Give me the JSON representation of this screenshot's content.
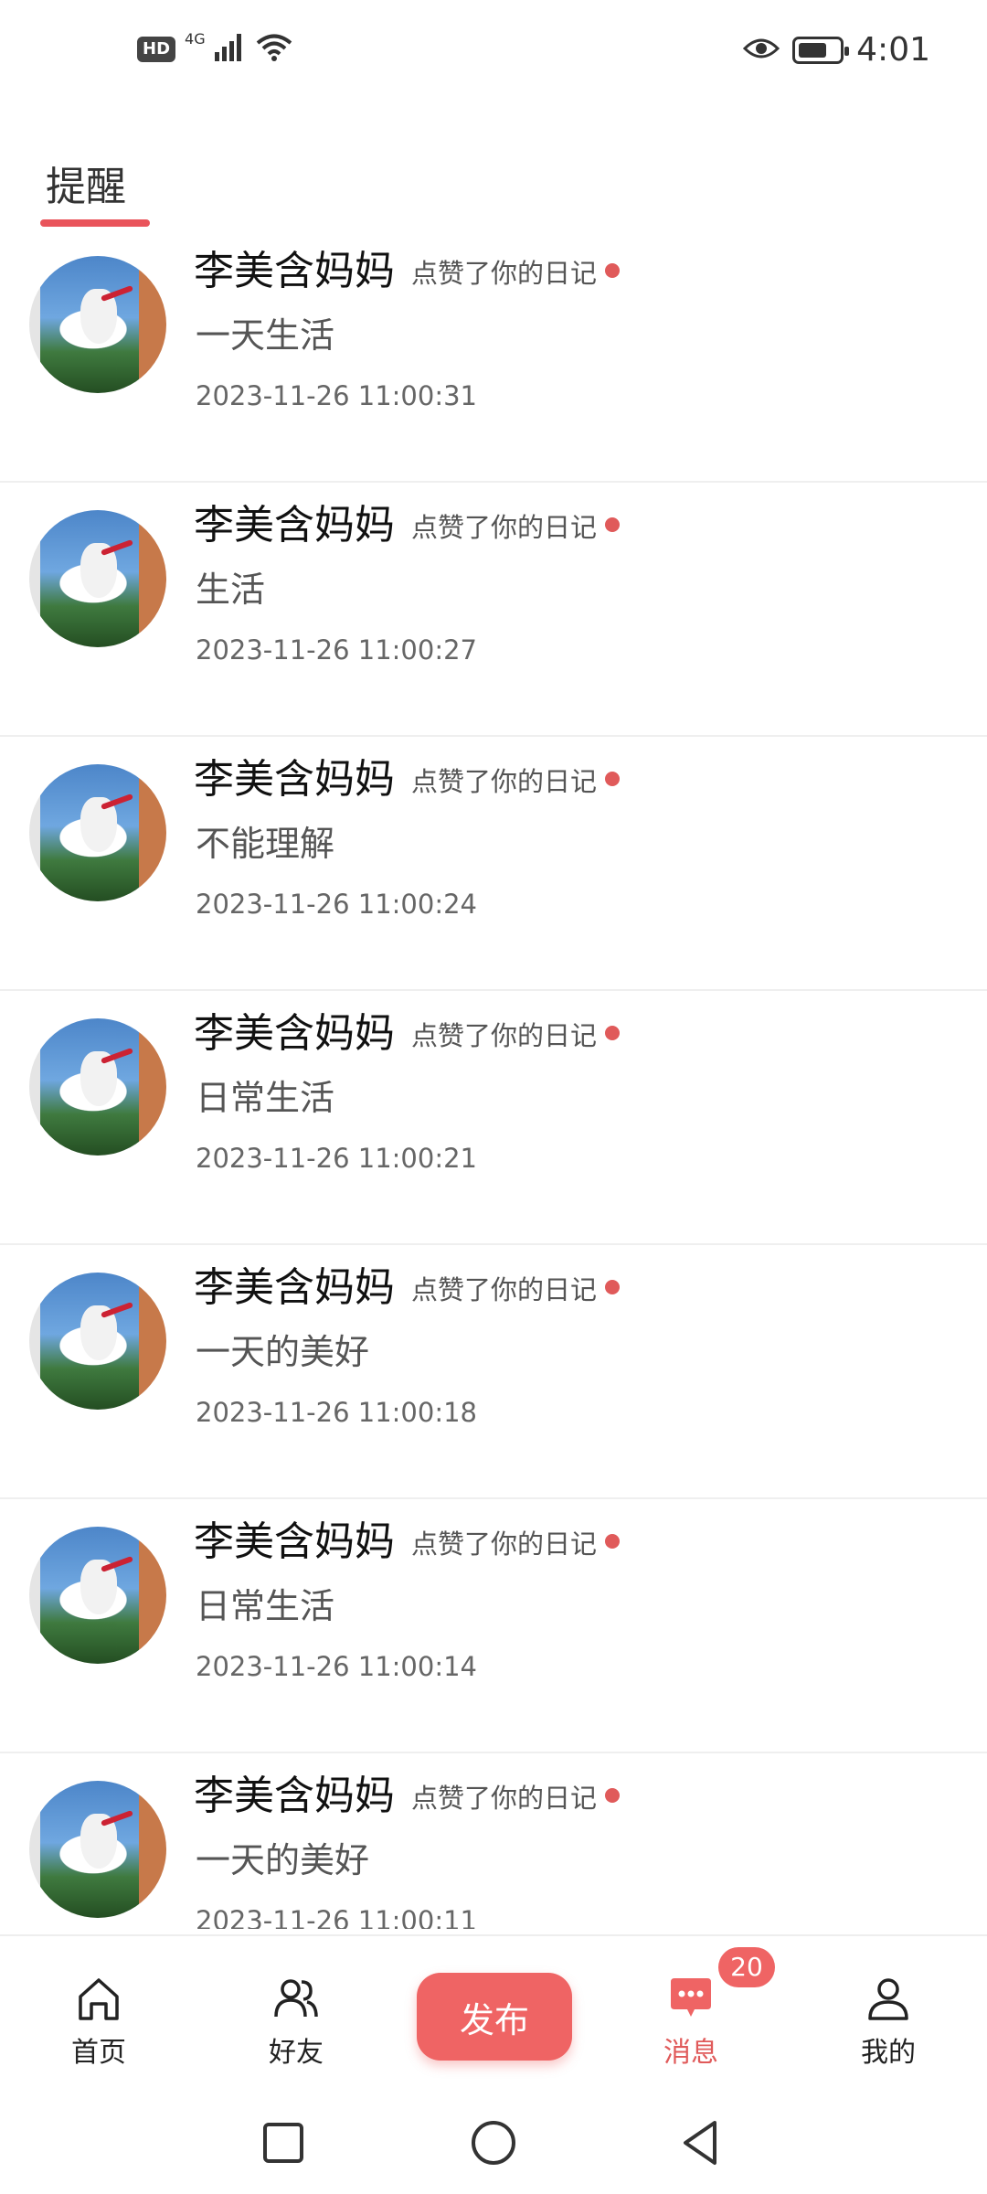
{
  "status_bar": {
    "hd": "HD",
    "network": "4G",
    "time": "4:01",
    "battery_level_pct": 70,
    "icons": [
      "signal-icon",
      "wifi-icon",
      "eye-icon",
      "battery-icon"
    ]
  },
  "section": {
    "title": "提醒"
  },
  "notifications": [
    {
      "name": "李美含妈妈",
      "action": "点赞了你的日记",
      "diary": "一天生活",
      "time": "2023-11-26 11:00:31"
    },
    {
      "name": "李美含妈妈",
      "action": "点赞了你的日记",
      "diary": "生活",
      "time": "2023-11-26 11:00:27"
    },
    {
      "name": "李美含妈妈",
      "action": "点赞了你的日记",
      "diary": "不能理解",
      "time": "2023-11-26 11:00:24"
    },
    {
      "name": "李美含妈妈",
      "action": "点赞了你的日记",
      "diary": "日常生活",
      "time": "2023-11-26 11:00:21"
    },
    {
      "name": "李美含妈妈",
      "action": "点赞了你的日记",
      "diary": "一天的美好",
      "time": "2023-11-26 11:00:18"
    },
    {
      "name": "李美含妈妈",
      "action": "点赞了你的日记",
      "diary": "日常生活",
      "time": "2023-11-26 11:00:14"
    },
    {
      "name": "李美含妈妈",
      "action": "点赞了你的日记",
      "diary": "一天的美好",
      "time": "2023-11-26 11:00:11"
    }
  ],
  "bottom_nav": {
    "home": "首页",
    "friends": "好友",
    "publish": "发布",
    "messages": "消息",
    "messages_badge": "20",
    "mine": "我的"
  },
  "colors": {
    "accent": "#ef6464",
    "unread_dot": "#e05a5a"
  }
}
